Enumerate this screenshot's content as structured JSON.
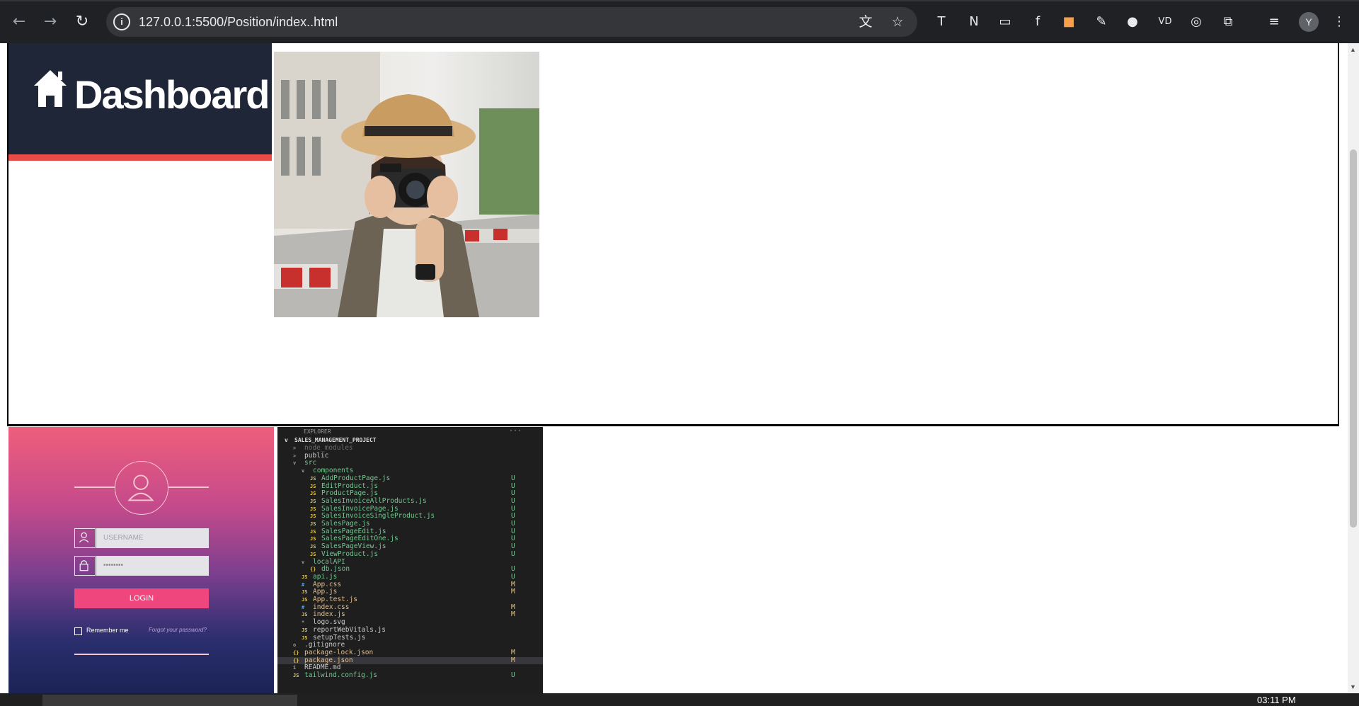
{
  "browser": {
    "url": "127.0.0.1:5500/Position/index..html",
    "profile_initial": "Y",
    "icons": [
      "back-icon",
      "forward-icon",
      "reload-icon",
      "site-info-icon",
      "translate-icon",
      "bookmark-star-icon",
      "extensions-icon",
      "media-icon",
      "menu-icon"
    ]
  },
  "page": {
    "dashboard_title": "Dashboard",
    "dashboard_accent": "#e94b47",
    "dashboard_bg": "#1f2637"
  },
  "login_image": {
    "username_placeholder": "USERNAME",
    "password_value": "••••••••",
    "login_label": "LOGIN",
    "remember_label": "Remember me",
    "forgot_label": "Forgot your password?",
    "button_color": "#f0467e"
  },
  "explorer_image": {
    "header": "EXPLORER",
    "project": "SALES_MANAGEMENT_PROJECT",
    "items": [
      {
        "name": "node_modules",
        "indent": 1,
        "icon": ">",
        "status": "",
        "color": "#6a6a6a"
      },
      {
        "name": "public",
        "indent": 1,
        "icon": ">",
        "status": "",
        "color": "#cccccc"
      },
      {
        "name": "src",
        "indent": 1,
        "icon": "v",
        "status": "",
        "color": "#73c991"
      },
      {
        "name": "components",
        "indent": 2,
        "icon": "v",
        "status": "",
        "color": "#73c991"
      },
      {
        "name": "AddProductPage.js",
        "indent": 3,
        "icon": "JS",
        "status": "U",
        "color": "#73c991"
      },
      {
        "name": "EditProduct.js",
        "indent": 3,
        "icon": "JS",
        "status": "U",
        "color": "#73c991"
      },
      {
        "name": "ProductPage.js",
        "indent": 3,
        "icon": "JS",
        "status": "U",
        "color": "#73c991"
      },
      {
        "name": "SalesInvoiceAllProducts.js",
        "indent": 3,
        "icon": "JS",
        "status": "U",
        "color": "#73c991"
      },
      {
        "name": "SalesInvoicePage.js",
        "indent": 3,
        "icon": "JS",
        "status": "U",
        "color": "#73c991"
      },
      {
        "name": "SalesInvoiceSingleProduct.js",
        "indent": 3,
        "icon": "JS",
        "status": "U",
        "color": "#73c991"
      },
      {
        "name": "SalesPage.js",
        "indent": 3,
        "icon": "JS",
        "status": "U",
        "color": "#73c991"
      },
      {
        "name": "SalesPageEdit.js",
        "indent": 3,
        "icon": "JS",
        "status": "U",
        "color": "#73c991"
      },
      {
        "name": "SalesPageEditOne.js",
        "indent": 3,
        "icon": "JS",
        "status": "U",
        "color": "#73c991"
      },
      {
        "name": "SalesPageView.js",
        "indent": 3,
        "icon": "JS",
        "status": "U",
        "color": "#73c991"
      },
      {
        "name": "ViewProduct.js",
        "indent": 3,
        "icon": "JS",
        "status": "U",
        "color": "#73c991"
      },
      {
        "name": "localAPI",
        "indent": 2,
        "icon": "v",
        "status": "",
        "color": "#73c991"
      },
      {
        "name": "db.json",
        "indent": 3,
        "icon": "{}",
        "status": "U",
        "color": "#73c991"
      },
      {
        "name": "api.js",
        "indent": 2,
        "icon": "JS",
        "status": "U",
        "color": "#73c991"
      },
      {
        "name": "App.css",
        "indent": 2,
        "icon": "#",
        "status": "M",
        "color": "#e2c08d"
      },
      {
        "name": "App.js",
        "indent": 2,
        "icon": "JS",
        "status": "M",
        "color": "#e2c08d"
      },
      {
        "name": "App.test.js",
        "indent": 2,
        "icon": "JS",
        "status": "",
        "color": "#e2c08d"
      },
      {
        "name": "index.css",
        "indent": 2,
        "icon": "#",
        "status": "M",
        "color": "#e2c08d"
      },
      {
        "name": "index.js",
        "indent": 2,
        "icon": "JS",
        "status": "M",
        "color": "#e2c08d"
      },
      {
        "name": "logo.svg",
        "indent": 2,
        "icon": "*",
        "status": "",
        "color": "#cccccc"
      },
      {
        "name": "reportWebVitals.js",
        "indent": 2,
        "icon": "JS",
        "status": "",
        "color": "#cccccc"
      },
      {
        "name": "setupTests.js",
        "indent": 2,
        "icon": "JS",
        "status": "",
        "color": "#cccccc"
      },
      {
        "name": ".gitignore",
        "indent": 1,
        "icon": "o",
        "status": "",
        "color": "#cccccc"
      },
      {
        "name": "package-lock.json",
        "indent": 1,
        "icon": "{}",
        "status": "M",
        "color": "#e2c08d"
      },
      {
        "name": "package.json",
        "indent": 1,
        "icon": "{}",
        "status": "M",
        "color": "#e2c08d"
      },
      {
        "name": "README.md",
        "indent": 1,
        "icon": "i",
        "status": "",
        "color": "#cccccc"
      },
      {
        "name": "tailwind.config.js",
        "indent": 1,
        "icon": "JS",
        "status": "U",
        "color": "#73c991"
      }
    ]
  },
  "taskbar": {
    "clock": "03:11 PM"
  }
}
